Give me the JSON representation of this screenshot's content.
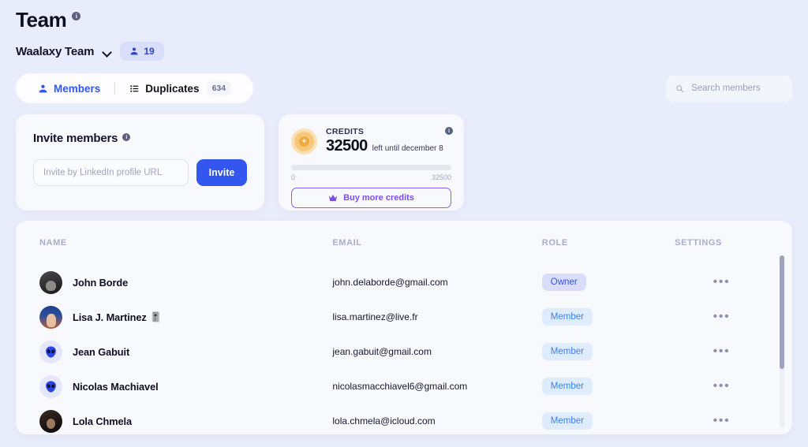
{
  "header": {
    "title": "Team",
    "info_icon": "info-icon",
    "team_name": "Waalaxy Team",
    "chevron_icon": "chevron-down-icon",
    "member_count_icon": "people-icon",
    "member_count": "19"
  },
  "tabs": [
    {
      "label": "Members",
      "icon": "people-icon",
      "active": true,
      "count": null
    },
    {
      "label": "Duplicates",
      "icon": "list-icon",
      "active": false,
      "count": "634"
    }
  ],
  "search": {
    "icon": "search-icon",
    "placeholder": "Search members",
    "value": ""
  },
  "invite_card": {
    "heading": "Invite members",
    "info_icon": "info-icon",
    "input_placeholder": "Invite by LinkedIn profile URL",
    "input_value": "",
    "button_label": "Invite",
    "button_color": "#3355f0"
  },
  "credits_card": {
    "icon": "coin-icon",
    "label": "CREDITS",
    "amount": "32500",
    "subtitle": "left until december 8",
    "info_icon": "info-icon",
    "progress_min": "0",
    "progress_max": "32500",
    "progress_percent": 0,
    "buy_button_label": "Buy more credits",
    "buy_button_icon": "crown-icon",
    "accent_color": "#8b5cf6"
  },
  "table": {
    "columns": [
      "NAME",
      "EMAIL",
      "ROLE",
      "SETTINGS"
    ],
    "rows": [
      {
        "name": "John Borde",
        "name_emoji": "",
        "avatar": "photo-avatar",
        "email": "john.delaborde@gmail.com",
        "role": "Owner",
        "role_style": "owner",
        "settings_icon": "more-options-icon"
      },
      {
        "name": "Lisa J. Martinez",
        "name_emoji": "🎚️",
        "avatar": "photo-avatar",
        "email": "lisa.martinez@live.fr",
        "role": "Member",
        "role_style": "member",
        "settings_icon": "more-options-icon"
      },
      {
        "name": "Jean Gabuit",
        "name_emoji": "",
        "avatar": "alien-avatar",
        "email": "jean.gabuit@gmail.com",
        "role": "Member",
        "role_style": "member",
        "settings_icon": "more-options-icon"
      },
      {
        "name": "Nicolas Machiavel",
        "name_emoji": "",
        "avatar": "alien-avatar",
        "email": "nicolasmacchiavel6@gmail.com",
        "role": "Member",
        "role_style": "member",
        "settings_icon": "more-options-icon"
      },
      {
        "name": "Lola Chmela",
        "name_emoji": "",
        "avatar": "photo-avatar",
        "email": "lola.chmela@icloud.com",
        "role": "Member",
        "role_style": "member",
        "settings_icon": "more-options-icon"
      }
    ]
  },
  "theme": {
    "page_background": "#e9ecfa",
    "card_background": "#f8f9fd",
    "primary_blue": "#3355f0",
    "member_badge_blue": "#3b82f6",
    "purple": "#8b5cf6"
  }
}
